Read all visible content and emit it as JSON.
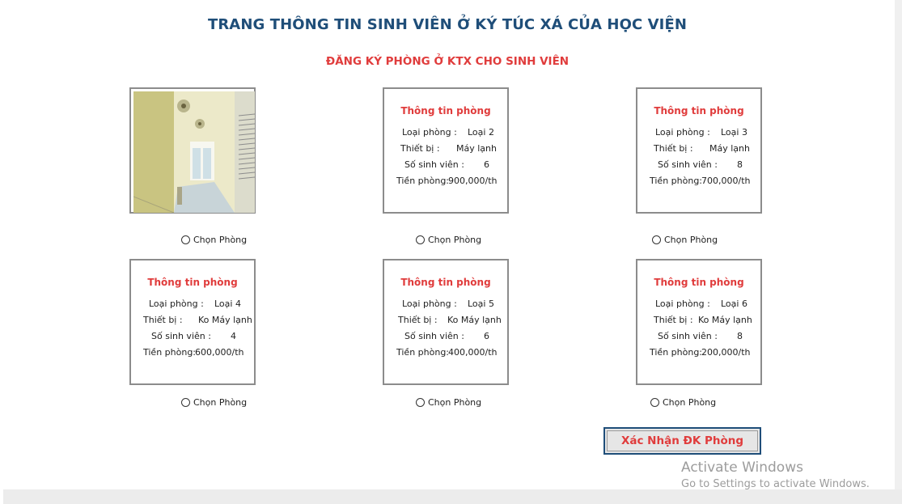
{
  "header": {
    "title": "TRANG THÔNG TIN SINH VIÊN Ở KÝ TÚC XÁ CỦA HỌC VIỆN",
    "subtitle": "ĐĂNG KÝ PHÒNG Ở KTX CHO SINH VIÊN"
  },
  "labels": {
    "card_title": "Thông tin phòng",
    "room_type": "Loại phòng :",
    "equipment": "Thiết bị :",
    "students": "Số sinh viên :",
    "price": "Tiền phòng:"
  },
  "rooms": [
    {
      "radio_label": "Chọn Phòng"
    },
    {
      "type": "Loại 2",
      "equipment": "Máy lạnh",
      "students": "6",
      "price": "900,000/th",
      "radio_label": "Chọn Phòng"
    },
    {
      "type": "Loại 3",
      "equipment": "Máy lạnh",
      "students": "8",
      "price": "700,000/th",
      "radio_label": "Chọn Phòng"
    },
    {
      "type": "Loại 4",
      "equipment": "Ko Máy lạnh",
      "students": "4",
      "price": "600,000/th",
      "radio_label": "Chọn Phòng"
    },
    {
      "type": "Loại 5",
      "equipment": "Ko Máy lạnh",
      "students": "6",
      "price": "400,000/th",
      "radio_label": "Chọn Phòng"
    },
    {
      "type": "Loại 6",
      "equipment": "Ko Máy lạnh",
      "students": "8",
      "price": "200,000/th",
      "radio_label": "Chọn Phòng"
    }
  ],
  "confirm_label": "Xác Nhận ĐK Phòng",
  "watermark": {
    "line1": "Activate Windows",
    "line2": "Go to Settings to activate Windows."
  },
  "colors": {
    "title": "#1f4e79",
    "accent": "#e03c3c"
  }
}
